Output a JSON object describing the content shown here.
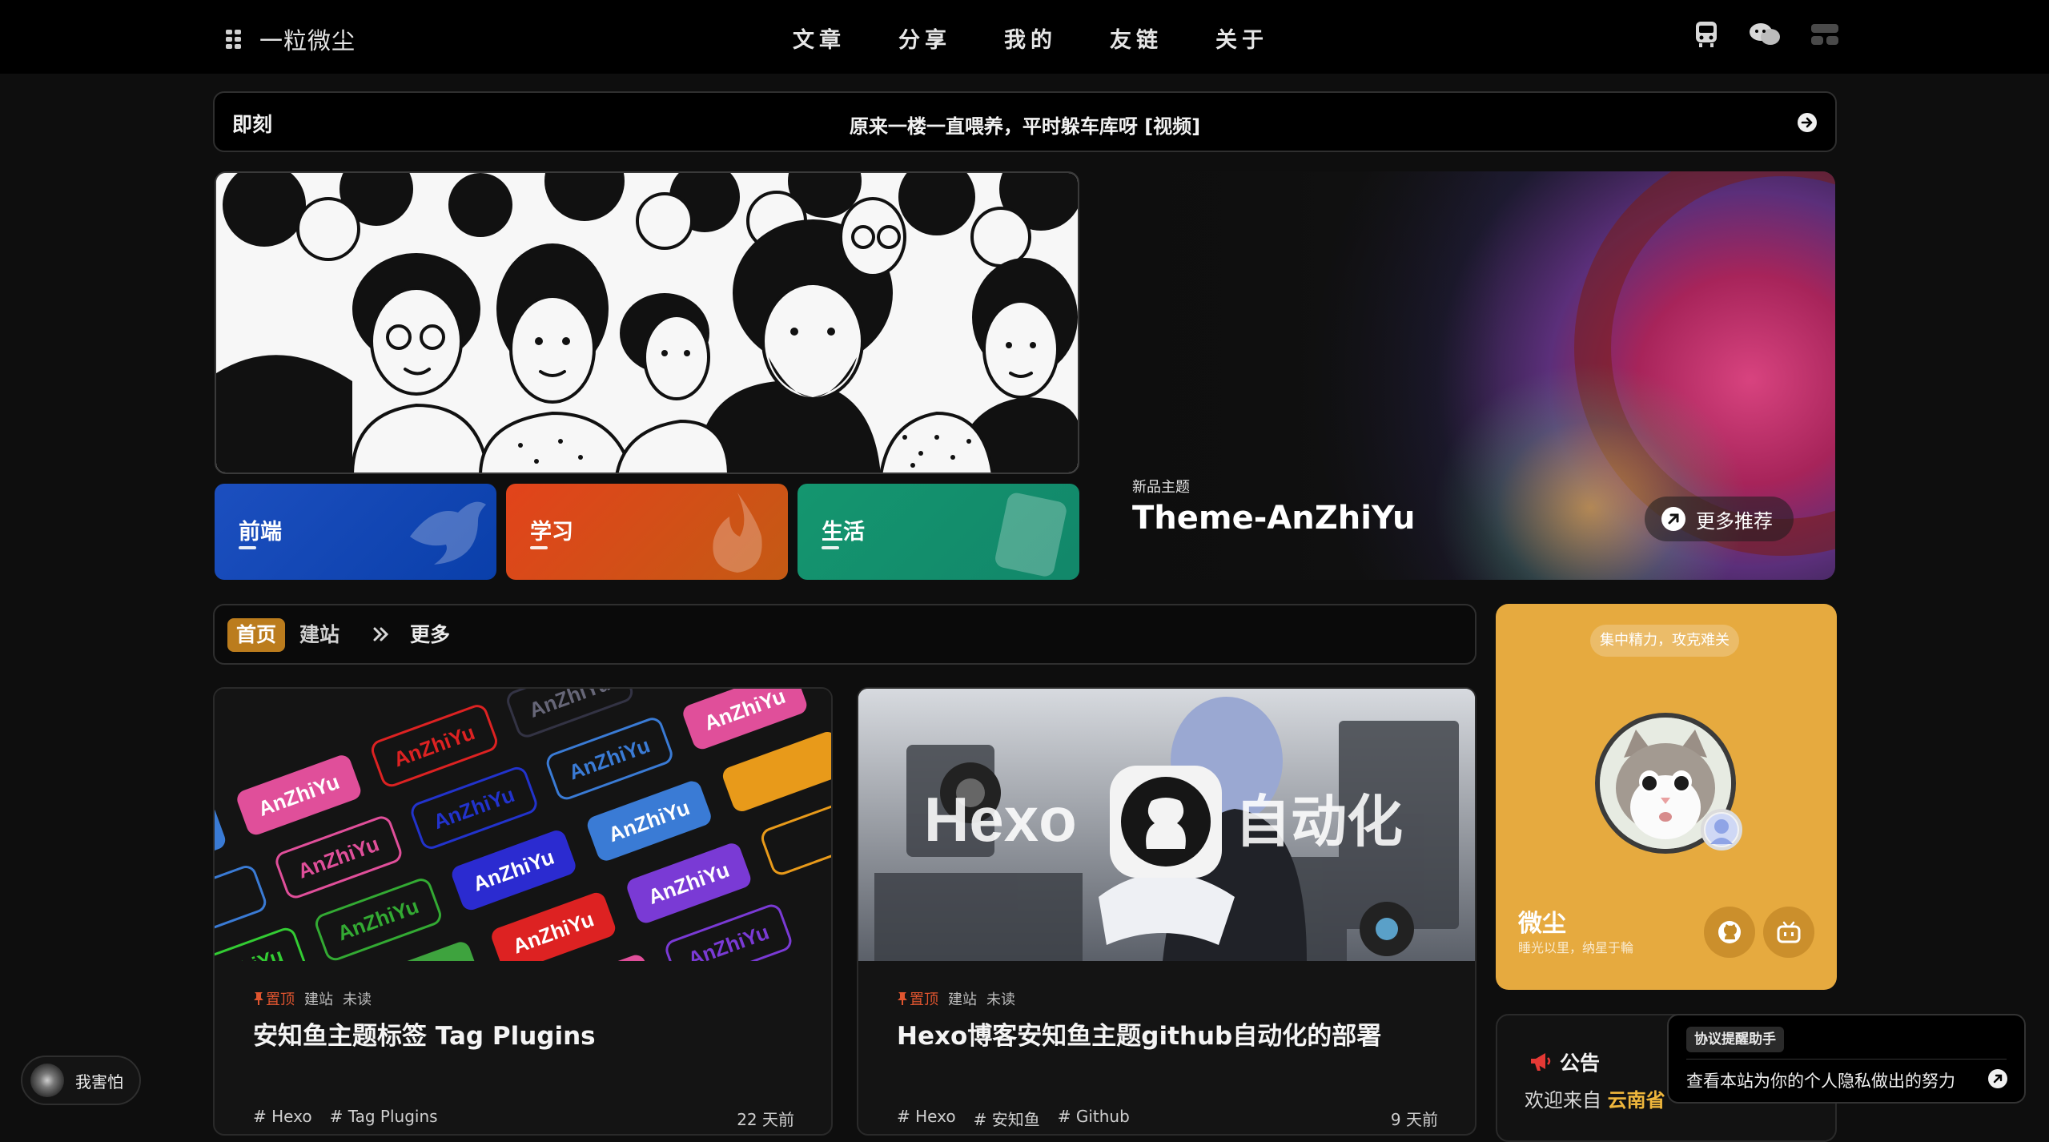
{
  "nav": {
    "site_title": "一粒微尘",
    "menu": [
      "文章",
      "分享",
      "我的",
      "友链",
      "关于"
    ]
  },
  "moment": {
    "label": "即刻",
    "text": "原来一楼一直喂养，平时躲车库呀 [视频]"
  },
  "categories": [
    {
      "label": "前端",
      "color": "#0a47b4"
    },
    {
      "label": "学习",
      "color": "#d5461a"
    },
    {
      "label": "生活",
      "color": "#13906d"
    }
  ],
  "feature": {
    "kicker": "新品主题",
    "title": "Theme-AnZhiYu",
    "more": "更多推荐"
  },
  "tabs": {
    "home": "首页",
    "site": "建站",
    "more": "更多"
  },
  "posts": [
    {
      "pin": "置顶",
      "category": "建站",
      "status": "未读",
      "title": "安知鱼主题标签 Tag Plugins",
      "tags": [
        "# Hexo",
        "# Tag Plugins"
      ],
      "time": "22 天前",
      "cover_text": "AnZhiYu"
    },
    {
      "pin": "置顶",
      "category": "建站",
      "status": "未读",
      "title": "Hexo博客安知鱼主题github自动化的部署",
      "tags": [
        "# Hexo",
        "# 安知鱼",
        "# Github"
      ],
      "time": "9 天前",
      "cover_left": "Hexo",
      "cover_right": "自动化"
    }
  ],
  "author": {
    "chip": "集中精力，攻克难关",
    "name": "微尘",
    "desc": "睡光以里，纳星于輪"
  },
  "notice": {
    "title": "公告",
    "prefix": "欢迎来自",
    "location": "云南省"
  },
  "privacy": {
    "tag": "协议提醒助手",
    "text": "查看本站为你的个人隐私做出的努力"
  },
  "music": {
    "label": "我害怕"
  },
  "colors": {
    "accent": "#bb7c1d",
    "author_bg": "#e6aa3f",
    "pin": "#e0552f"
  }
}
